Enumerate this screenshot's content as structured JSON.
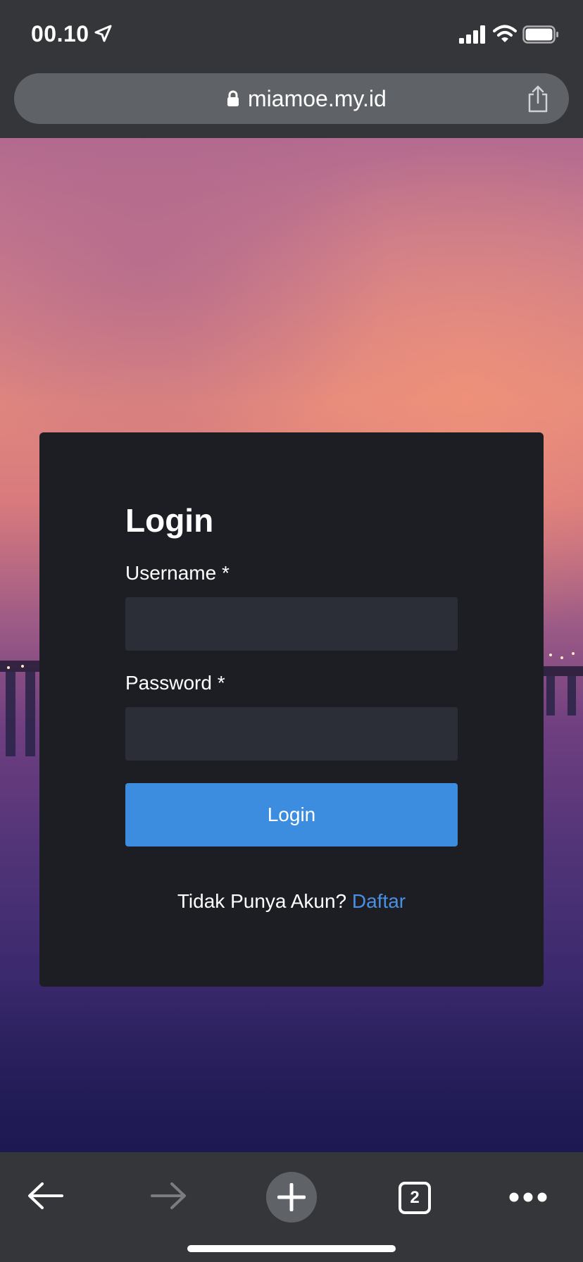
{
  "status_bar": {
    "time": "00.10",
    "icons": [
      "location-arrow-icon",
      "signal-icon",
      "wifi-icon",
      "battery-icon"
    ]
  },
  "url_bar": {
    "url": "miamoe.my.id",
    "icons": [
      "lock-icon",
      "share-icon"
    ]
  },
  "login": {
    "title": "Login",
    "username_label": "Username *",
    "username_value": "",
    "password_label": "Password *",
    "password_value": "",
    "button_label": "Login",
    "signup_prompt": "Tidak Punya Akun?",
    "signup_link": "Daftar"
  },
  "toolbar": {
    "tab_count": "2",
    "icons": [
      "back-arrow-icon",
      "forward-arrow-icon",
      "new-tab-plus-icon",
      "tabs-icon",
      "more-options-icon"
    ]
  },
  "colors": {
    "chrome_bg": "#35363a",
    "url_pill": "#5f6368",
    "card_bg": "#1c1e24",
    "input_bg": "#2b2e36",
    "button": "#3c8de0",
    "link": "#4a90e2"
  }
}
